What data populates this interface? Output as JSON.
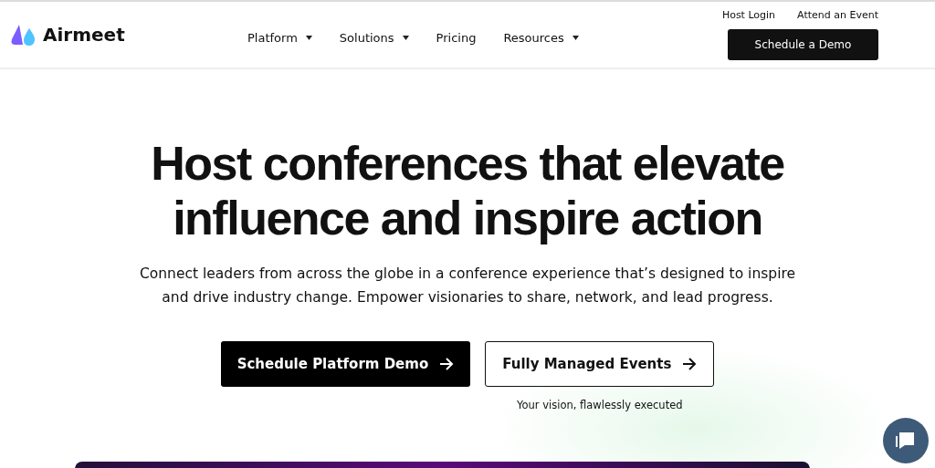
{
  "header": {
    "logo": "Airmeet",
    "nav": [
      {
        "label": "Platform",
        "dropdown": true
      },
      {
        "label": "Solutions",
        "dropdown": true
      },
      {
        "label": "Pricing",
        "dropdown": false
      },
      {
        "label": "Resources",
        "dropdown": true
      }
    ],
    "top_links": [
      "Host Login",
      "Attend an Event"
    ],
    "cta": "Schedule a Demo"
  },
  "hero": {
    "headline": "Host conferences that elevate influence and inspire action",
    "subtitle": "Connect leaders from across the globe in a conference experience that’s designed to inspire and drive industry change. Empower visionaries to share, network, and lead progress.",
    "buttons": [
      {
        "label": "Schedule Platform Demo",
        "kind": "primary"
      },
      {
        "label": "Fully Managed Events",
        "kind": "outline"
      }
    ],
    "caption": "Your vision, flawlessly executed"
  }
}
